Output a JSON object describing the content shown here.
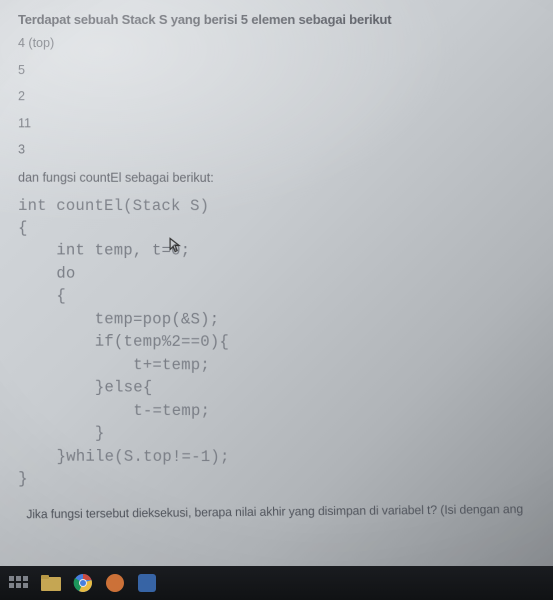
{
  "intro": "Terdapat sebuah Stack S yang berisi 5 elemen sebagai berikut",
  "stack": {
    "top_label": "4 (top)",
    "items": [
      "5",
      "2",
      "11",
      "3"
    ]
  },
  "mid": "dan fungsi countEl sebagai berikut:",
  "code": {
    "l1": "int countEl(Stack S)",
    "l2": "{",
    "l3": "    int temp, t=0;",
    "l4": "    do",
    "l5": "    {",
    "l6": "        temp=pop(&S);",
    "l7": "        if(temp%2==0){",
    "l8": "            t+=temp;",
    "l9": "        }else{",
    "l10": "            t-=temp;",
    "l11": "        }",
    "l12": "    }while(S.top!=-1);",
    "l13": "}"
  },
  "outro": "Jika fungsi tersebut dieksekusi, berapa nilai akhir yang disimpan di variabel t? (Isi dengan ang",
  "cursor_glyph": "↖"
}
